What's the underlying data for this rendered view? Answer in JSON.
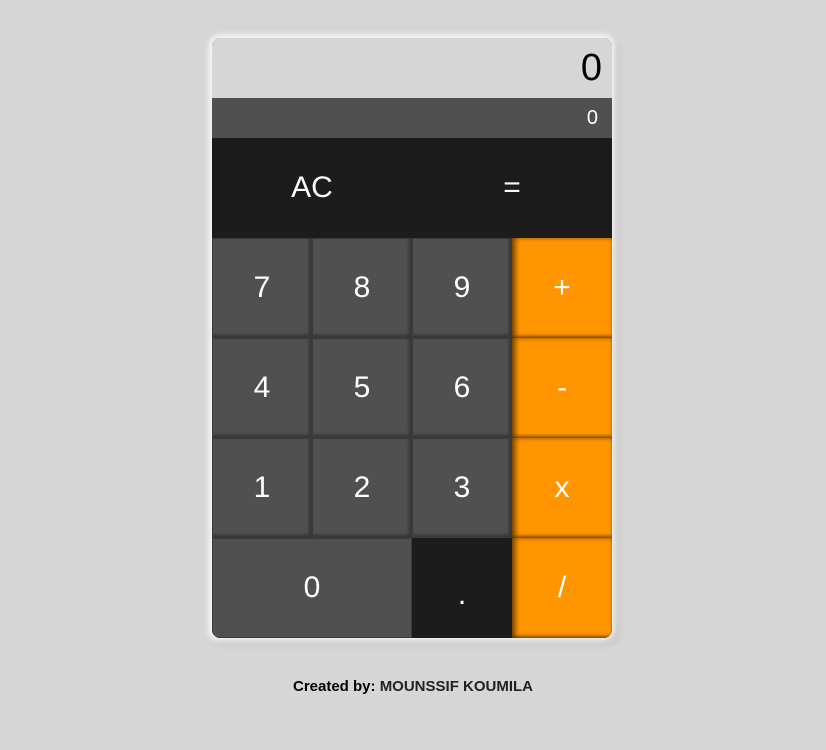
{
  "display": {
    "main": "0",
    "sub": "0"
  },
  "keys": {
    "clear": "AC",
    "equals": "=",
    "seven": "7",
    "eight": "8",
    "nine": "9",
    "plus": "+",
    "four": "4",
    "five": "5",
    "six": "6",
    "minus": "-",
    "one": "1",
    "two": "2",
    "three": "3",
    "multiply": "x",
    "zero": "0",
    "decimal": ".",
    "divide": "/"
  },
  "footer": {
    "prefix": "Created by: ",
    "author": "MOUNSSIF KOUMILA"
  },
  "colors": {
    "background": "#d6d6d6",
    "key_number": "#505050",
    "key_dark": "#1c1c1c",
    "key_operator": "#ff9500"
  }
}
